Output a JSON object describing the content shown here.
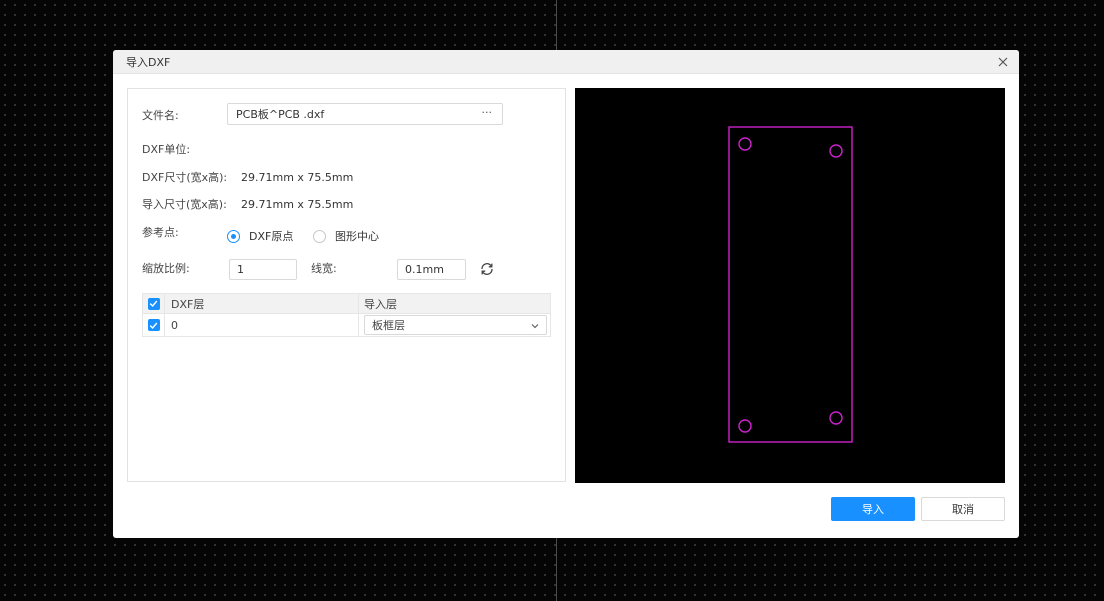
{
  "dialog": {
    "title": "导入DXF",
    "close_icon": "close-icon"
  },
  "form": {
    "file_name_label": "文件名:",
    "file_name_value": "PCB板^PCB .dxf",
    "browse_label": "···",
    "dxf_unit_label": "DXF单位:",
    "dxf_size_label": "DXF尺寸(宽x高):",
    "dxf_size_value": "29.71mm x 75.5mm",
    "import_size_label": "导入尺寸(宽x高):",
    "import_size_value": "29.71mm x 75.5mm",
    "reference_label": "参考点:",
    "reference_options": [
      {
        "label": "DXF原点",
        "selected": true
      },
      {
        "label": "图形中心",
        "selected": false
      }
    ],
    "scale_label": "缩放比例:",
    "scale_value": "1",
    "line_width_label": "线宽:",
    "line_width_value": "0.1mm",
    "refresh_icon": "refresh-icon"
  },
  "layer_table": {
    "headers": [
      "DXF层",
      "导入层"
    ],
    "header_checked": true,
    "rows": [
      {
        "checked": true,
        "dxf_layer": "0",
        "import_layer": "板框层"
      }
    ]
  },
  "preview": {
    "background": "#000000",
    "stroke_color": "#cc22cc"
  },
  "buttons": {
    "import_label": "导入",
    "cancel_label": "取消"
  },
  "colors": {
    "accent": "#1890ff"
  }
}
